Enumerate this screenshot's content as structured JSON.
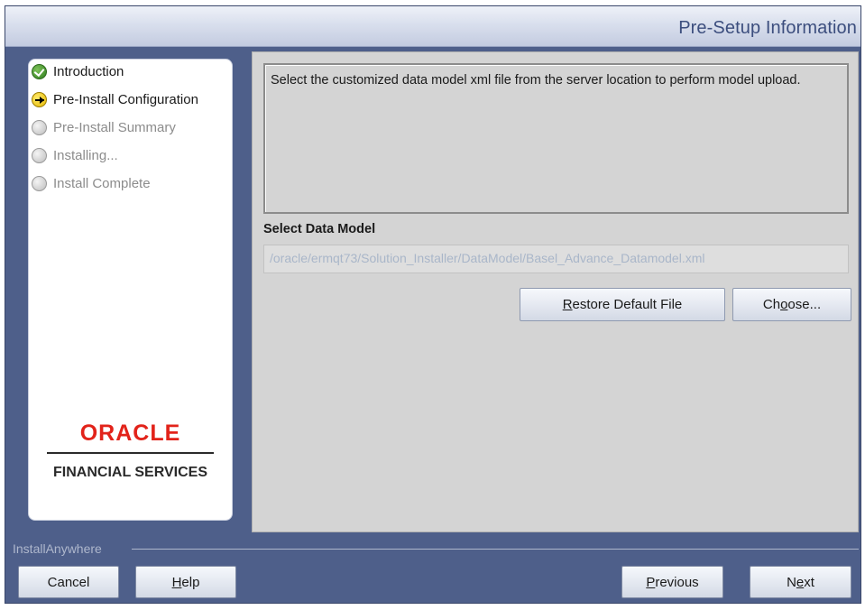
{
  "window": {
    "title": "Pre-Setup Information"
  },
  "steps": [
    {
      "label": "Introduction",
      "state": "done"
    },
    {
      "label": "Pre-Install Configuration",
      "state": "current"
    },
    {
      "label": "Pre-Install Summary",
      "state": "pending"
    },
    {
      "label": "Installing...",
      "state": "pending"
    },
    {
      "label": "Install Complete",
      "state": "pending"
    }
  ],
  "logo": {
    "brand": "ORACLE",
    "tagline": "FINANCIAL SERVICES"
  },
  "content": {
    "description": "Select the customized data model xml file from the server location to perform model upload.",
    "section_label": "Select Data Model",
    "path_value": "/oracle/ermqt73/Solution_Installer/DataModel/Basel_Advance_Datamodel.xml",
    "restore_button": {
      "mnemonic": "R",
      "rest": "estore Default File"
    },
    "choose_button": {
      "pre": "Ch",
      "mnemonic": "o",
      "post": "ose..."
    }
  },
  "footer": {
    "brand": "InstallAnywhere",
    "cancel": "Cancel",
    "help": {
      "mnemonic": "H",
      "rest": "elp"
    },
    "previous": {
      "mnemonic": "P",
      "rest": "revious"
    },
    "next": {
      "pre": "N",
      "mnemonic": "e",
      "post": "xt"
    }
  },
  "colors": {
    "frame": "#4e5f8a",
    "header_text": "#3c4e7e",
    "oracle_red": "#e2231a"
  }
}
